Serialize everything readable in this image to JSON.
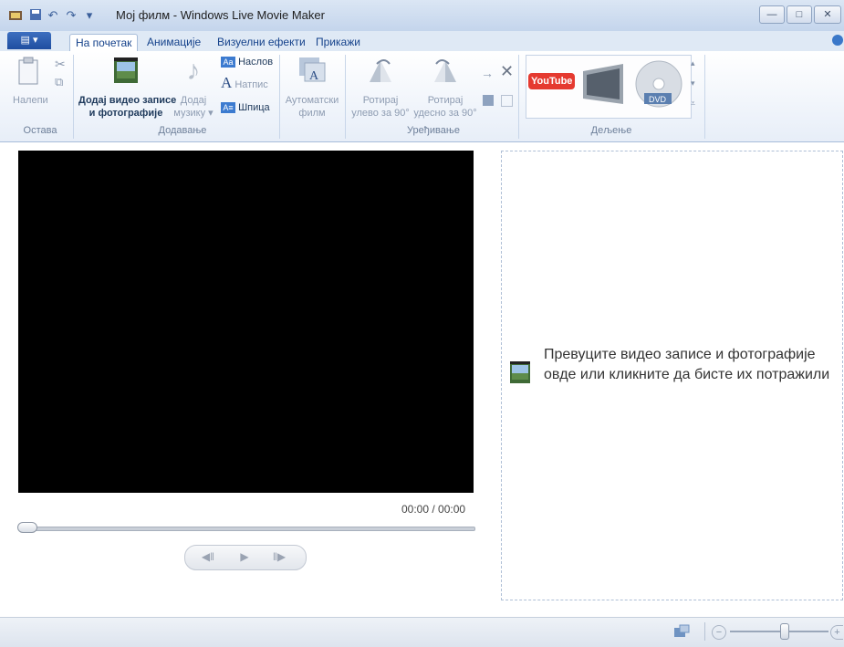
{
  "window": {
    "title": "Мој филм - Windows Live Movie Maker",
    "quick_access": [
      "save-icon",
      "undo-icon",
      "redo-icon",
      "customize-dropdown-icon"
    ],
    "controls": [
      "minimize-icon",
      "maximize-icon",
      "close-icon"
    ]
  },
  "tabs": [
    {
      "label": "На почетак",
      "active": true
    },
    {
      "label": "Анимације"
    },
    {
      "label": "Визуелни ефекти"
    },
    {
      "label": "Прикажи"
    }
  ],
  "ribbon": {
    "groups": {
      "clipboard": "Остава",
      "add": "Додавање",
      "editing": "Уређивање",
      "sharing": "Дељење"
    },
    "buttons": {
      "paste": "Налепи",
      "add_videos_line1": "Додај видео записе",
      "add_videos_line2": "и фотографије",
      "add_music_line1": "Додај",
      "add_music_line2": "музику ▾",
      "title": "Наслов",
      "caption": "Натпис",
      "credits": "Шпица",
      "automovie_line1": "Аутоматски",
      "automovie_line2": "филм",
      "rotate_left_line1": "Ротирај",
      "rotate_left_line2": "улево за 90°",
      "rotate_right_line1": "Ротирај",
      "rotate_right_line2": "удесно за 90°"
    },
    "share_targets": [
      "YouTube",
      "TV",
      "DVD"
    ],
    "youtube_text": "YouTube",
    "dvd_text": "DVD"
  },
  "preview": {
    "timecode": "00:00 / 00:00",
    "seek_position": 0
  },
  "storyboard": {
    "hint": "Превуците видео записе и фотографије овде или кликните да бисте их потражили"
  },
  "status": {
    "zoom_level": 0.55
  },
  "colors": {
    "accent": "#1f4ea0",
    "ribbon_bg": "#e7eef8",
    "preview_bg": "#000000"
  }
}
